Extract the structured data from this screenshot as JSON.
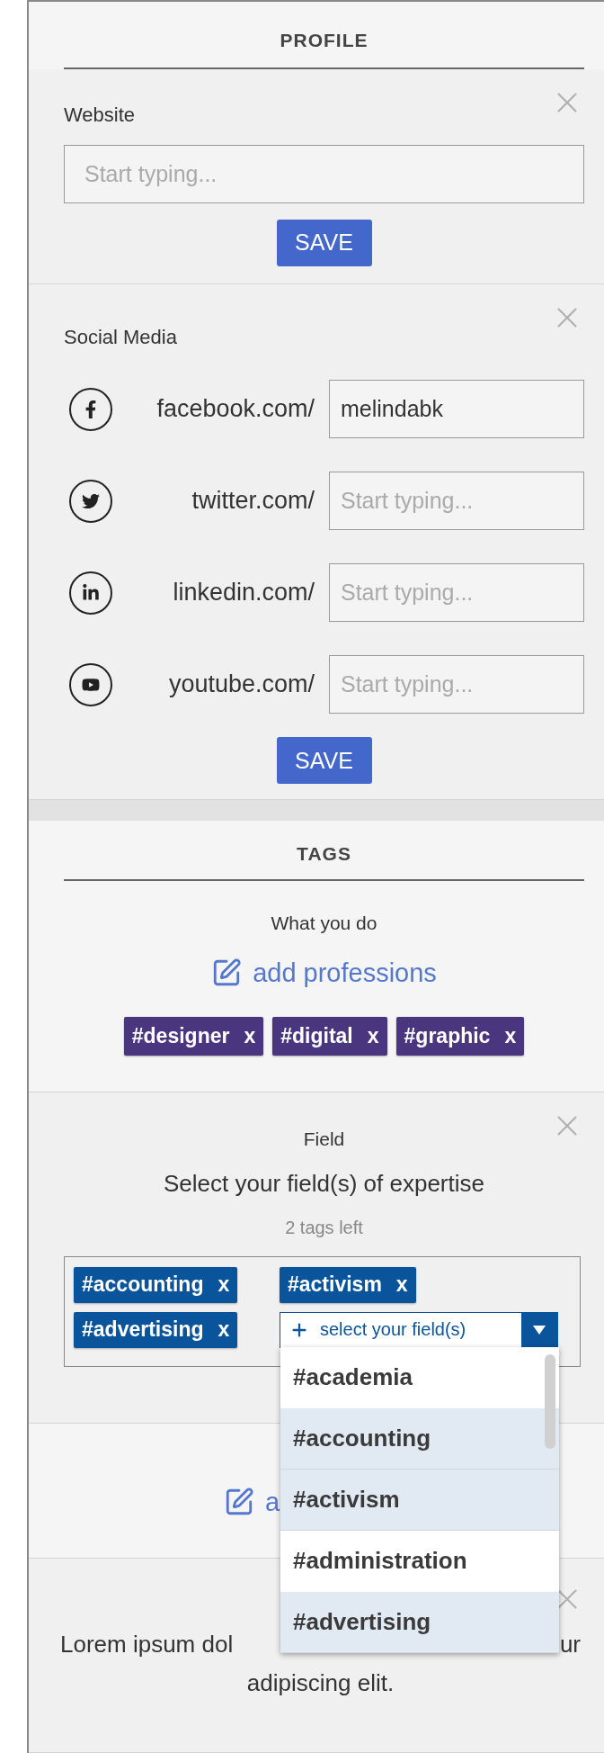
{
  "profile": {
    "title": "PROFILE"
  },
  "website": {
    "label": "Website",
    "placeholder": "Start typing...",
    "button": "SAVE"
  },
  "social": {
    "label": "Social Media",
    "button": "SAVE",
    "rows": [
      {
        "kind": "facebook",
        "prefix": "facebook.com/",
        "value": "melindabk"
      },
      {
        "kind": "twitter",
        "prefix": "twitter.com/",
        "placeholder": "Start typing..."
      },
      {
        "kind": "linkedin",
        "prefix": "linkedin.com/",
        "placeholder": "Start typing..."
      },
      {
        "kind": "youtube",
        "prefix": "youtube.com/",
        "placeholder": "Start typing..."
      }
    ]
  },
  "tags": {
    "title": "TAGS",
    "label": "What you do",
    "link": "add professions",
    "items": [
      {
        "label": "#designer",
        "remove": "x"
      },
      {
        "label": "#digital",
        "remove": "x"
      },
      {
        "label": "#graphic",
        "remove": "x"
      }
    ]
  },
  "field": {
    "label": "Field",
    "heading": "Select your field(s) of expertise",
    "hint": "2 tags left",
    "items": [
      {
        "label": "#accounting",
        "remove": "x"
      },
      {
        "label": "#activism",
        "remove": "x"
      },
      {
        "label": "#advertising",
        "remove": "x"
      }
    ],
    "select": {
      "placeholder": "select your field(s)",
      "expanded": true,
      "options": [
        {
          "label": "#academia",
          "selected": false
        },
        {
          "label": "#accounting",
          "selected": true
        },
        {
          "label": "#activism",
          "selected": true
        },
        {
          "label": "#administration",
          "selected": false
        },
        {
          "label": "#advertising",
          "selected": true
        }
      ]
    }
  },
  "next_section": {
    "link": "a"
  },
  "about": {
    "line_1_start": "Lorem ipsum dol",
    "line_1_end": "ur",
    "line_2": "adipiscing elit."
  }
}
